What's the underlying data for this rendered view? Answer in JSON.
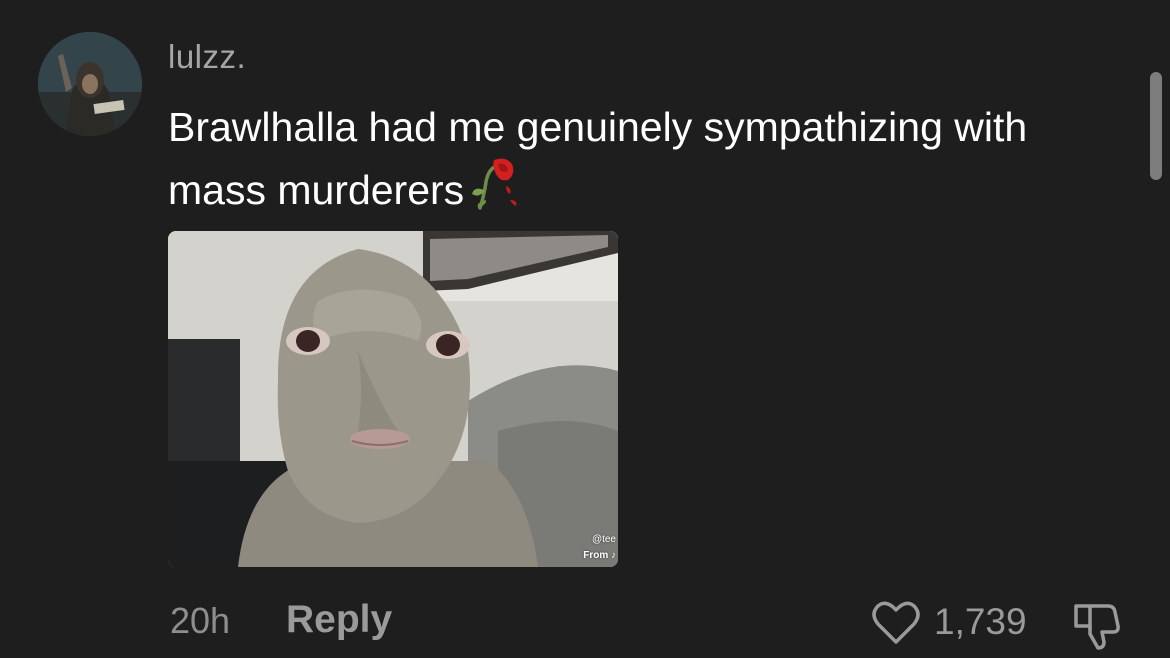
{
  "comment": {
    "username": "lulzz.",
    "text": "Brawlhalla had me genuinely sympathizing with mass murderers",
    "emoji_icon": "wilted-rose-icon",
    "media": {
      "watermark_handle": "@tee",
      "watermark_from": "From"
    },
    "timestamp": "20h",
    "reply_label": "Reply",
    "like_icon": "heart-outline-icon",
    "like_count": "1,739",
    "dislike_icon": "thumbs-down-outline-icon"
  },
  "colors": {
    "background": "#1e1e1e",
    "username": "#a6a6a6",
    "text": "#ffffff",
    "meta": "#9a9a9a"
  }
}
